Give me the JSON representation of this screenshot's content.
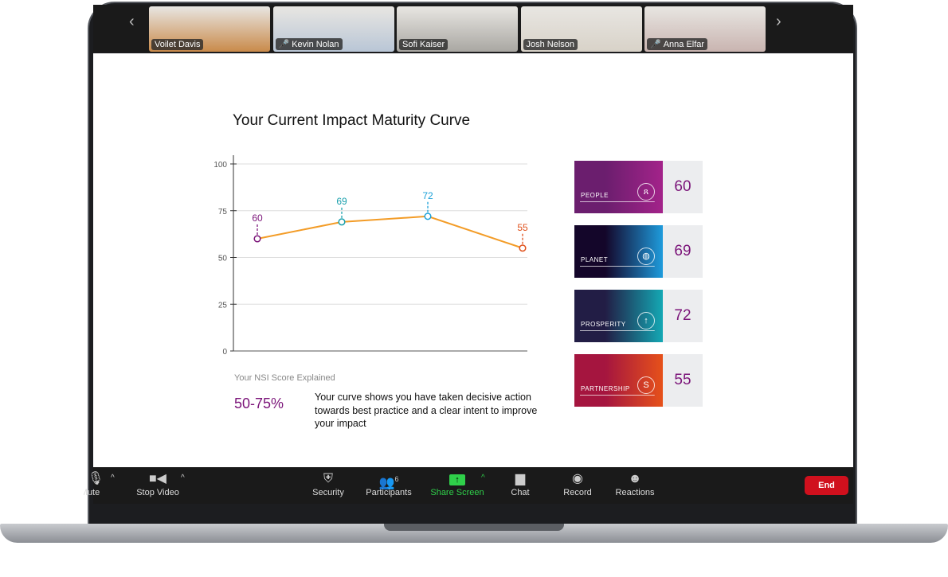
{
  "participants": [
    {
      "name": "Voilet Davis",
      "muted": false,
      "bg": "#c98a4a"
    },
    {
      "name": "Kevin Nolan",
      "muted": true,
      "bg": "#b9c6d6"
    },
    {
      "name": "Sofi Kaiser",
      "muted": false,
      "bg": "#a9a7a2"
    },
    {
      "name": "Josh Nelson",
      "muted": false,
      "bg": "#d8d2c8"
    },
    {
      "name": "Anna Elfar",
      "muted": true,
      "bg": "#c9b4b0"
    }
  ],
  "toolbar": {
    "mute": "Mute",
    "stop_video": "Stop Video",
    "security": "Security",
    "participants": "Participants",
    "participant_count": "6",
    "share_screen": "Share Screen",
    "chat": "Chat",
    "record": "Record",
    "reactions": "Reactions",
    "end": "End"
  },
  "slide": {
    "title": "Your Current Impact Maturity Curve",
    "explained_label": "Your NSI Score Explained",
    "range": "50-75%",
    "description": "Your curve shows you have taken decisive action towards best practice and a clear intent to improve your impact",
    "cards": [
      {
        "label": "PEOPLE",
        "value": "60",
        "icon": "people-icon",
        "gradient": [
          "#6b1e6e",
          "#a3238a"
        ]
      },
      {
        "label": "PLANET",
        "value": "69",
        "icon": "globe-icon",
        "gradient": [
          "#14062a",
          "#1e9bdc"
        ]
      },
      {
        "label": "PROSPERITY",
        "value": "72",
        "icon": "arrow-up-icon",
        "gradient": [
          "#221d45",
          "#14a8b4"
        ]
      },
      {
        "label": "PARTNERSHIP",
        "value": "55",
        "icon": "swirl-icon",
        "gradient": [
          "#a5153f",
          "#e6511a"
        ]
      }
    ]
  },
  "chart_data": {
    "type": "line",
    "ylim": [
      0,
      100
    ],
    "yticks": [
      "0",
      "25",
      "50",
      "75",
      "100"
    ],
    "grid": true,
    "line_color": "#f39c27",
    "points": [
      {
        "label": "60",
        "value": 60,
        "color": "#7b1479"
      },
      {
        "label": "69",
        "value": 69,
        "color": "#1aa0ad"
      },
      {
        "label": "72",
        "value": 72,
        "color": "#1ba0d8"
      },
      {
        "label": "55",
        "value": 55,
        "color": "#e0521d"
      }
    ]
  }
}
